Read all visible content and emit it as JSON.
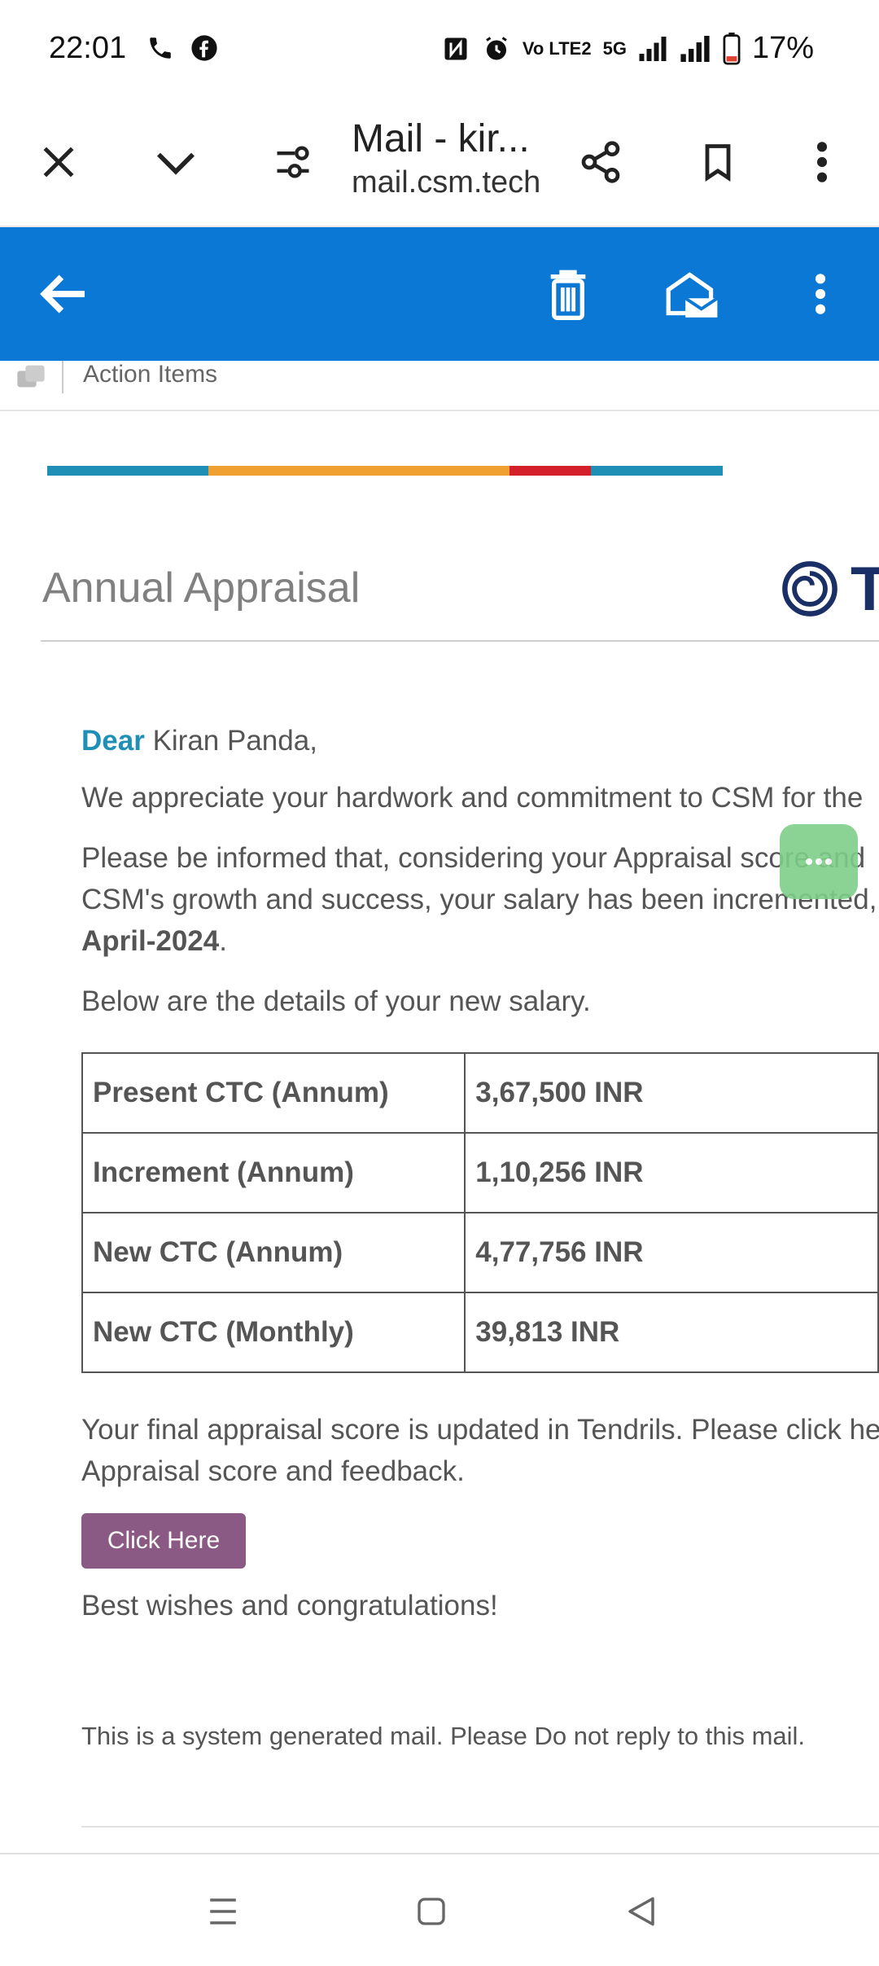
{
  "status_bar": {
    "time": "22:01",
    "left_icons": [
      "phone-icon",
      "facebook-icon"
    ],
    "right_icons": [
      "nfc-icon",
      "alarm-icon",
      "volte-icon",
      "signal-5g-icon",
      "signal-icon",
      "battery-icon"
    ],
    "volte_label": "Vo LTE2",
    "network_label": "5G",
    "battery": "17%"
  },
  "browser": {
    "close_icon": "close-icon",
    "collapse_icon": "chevron-down-icon",
    "site_settings_icon": "tune-icon",
    "title": "Mail - kir...",
    "url": "mail.csm.tech",
    "share_icon": "share-icon",
    "bookmark_icon": "bookmark-icon",
    "menu_icon": "more-vert-icon"
  },
  "mail_toolbar": {
    "background": "#0a78d4",
    "back_icon": "arrow-back-icon",
    "delete_icon": "trash-icon",
    "mark_read_icon": "envelope-open-icon",
    "more_icon": "more-vert-icon"
  },
  "category": {
    "label": "Action Items"
  },
  "email": {
    "title": "Annual Appraisal",
    "logo_letter": "T",
    "greeting": "Dear",
    "recipient": "Kiran Panda,",
    "para1": "We appreciate your hardwork and commitment to CSM for the",
    "para2_line1": "Please be informed that, considering your Appraisal score and",
    "para2_line2": "CSM's growth and success, your salary has been incremented,",
    "effective_date": "April-2024",
    "para2_end": ".",
    "para3": "Below are the details of your new salary.",
    "table": [
      {
        "label": "Present CTC (Annum)",
        "value": "3,67,500 INR"
      },
      {
        "label": "Increment (Annum)",
        "value": "1,10,256 INR"
      },
      {
        "label": "New CTC (Annum)",
        "value": "4,77,756 INR"
      },
      {
        "label": "New CTC (Monthly)",
        "value": "39,813 INR"
      }
    ],
    "para4_line1": "Your final appraisal score is updated in Tendrils. Please click he",
    "para4_line2": "Appraisal score and feedback.",
    "button_label": "Click Here",
    "button_color": "#8b5a84",
    "closing": "Best wishes and congratulations!",
    "footer": "This is a system generated mail. Please Do not reply to this mail."
  },
  "color_bar": [
    "#1f8fb5",
    "#f0a030",
    "#d4202a",
    "#1f8fb5"
  ],
  "nav": {
    "recents_icon": "recents-icon",
    "home_icon": "home-icon",
    "back_icon": "back-triangle-icon"
  }
}
